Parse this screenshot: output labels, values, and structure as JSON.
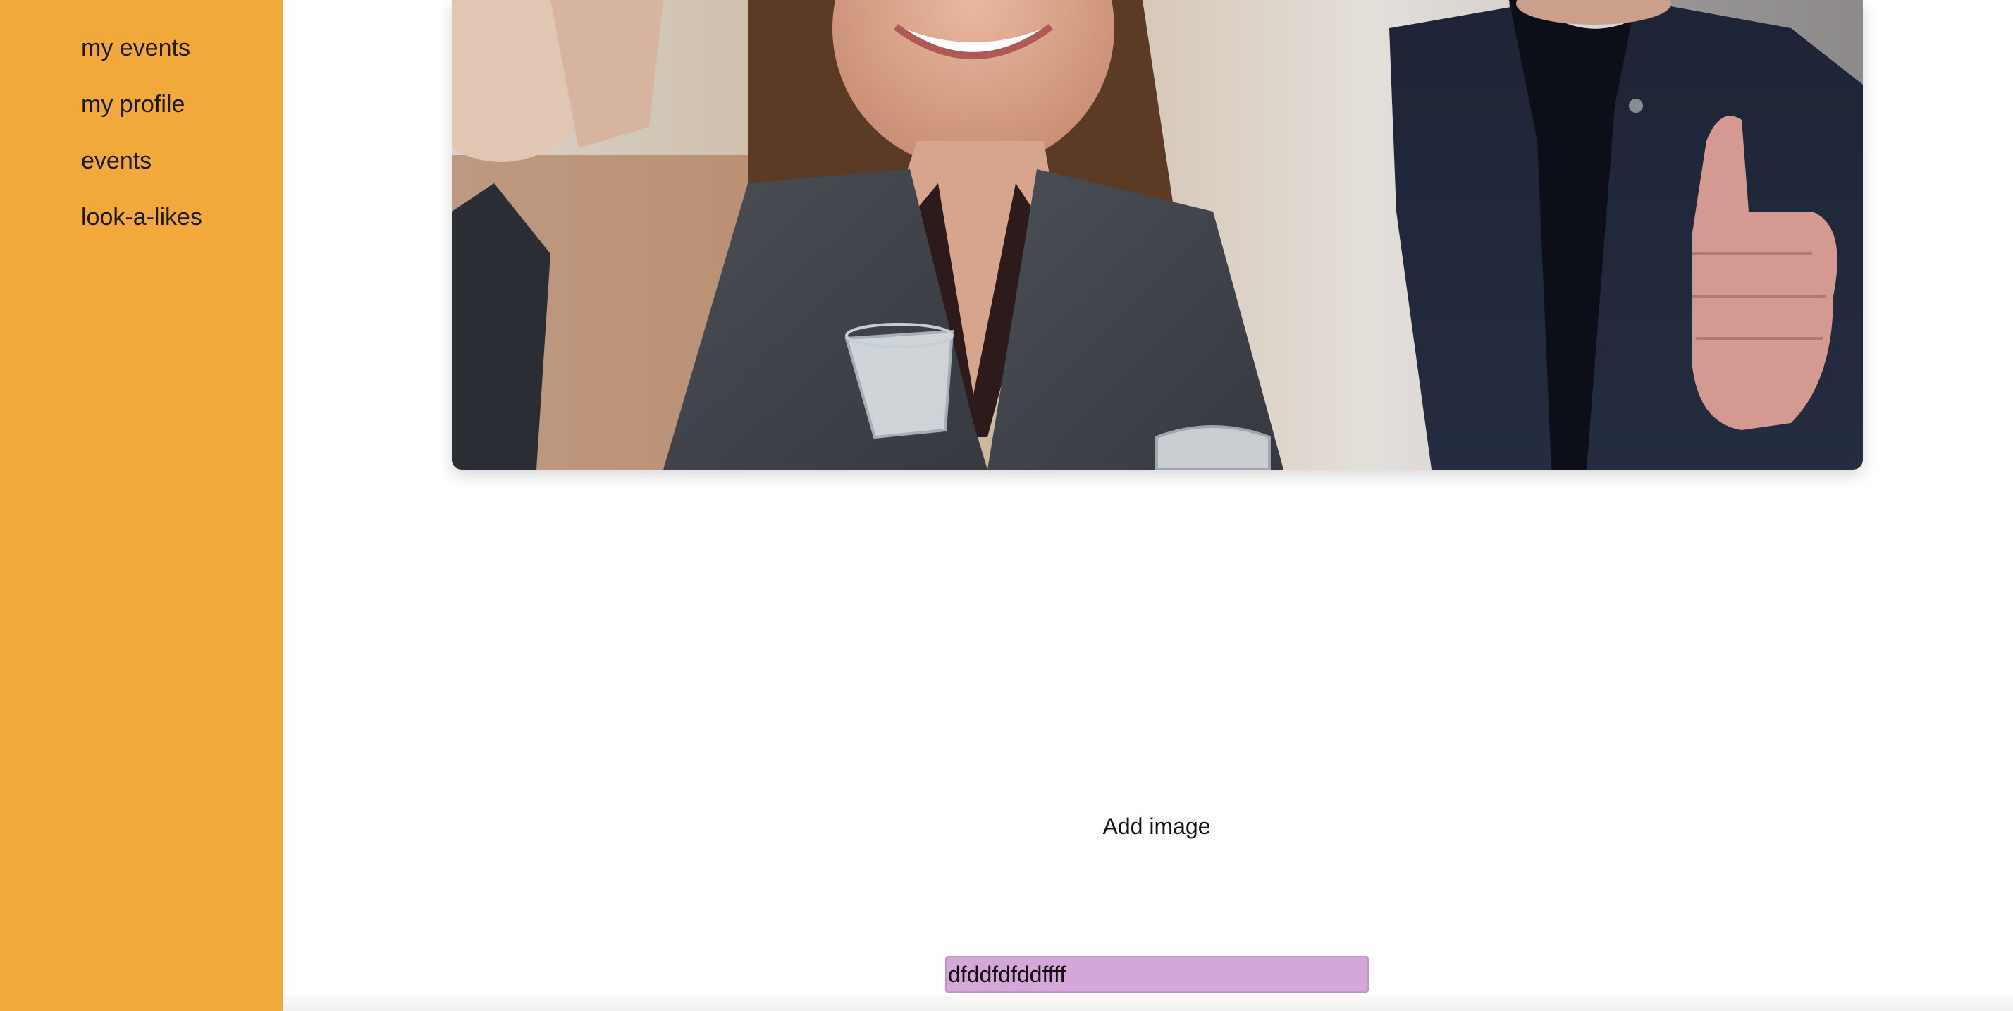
{
  "sidebar": {
    "items": [
      {
        "label": "my events"
      },
      {
        "label": "my profile"
      },
      {
        "label": "events"
      },
      {
        "label": "look-a-likes"
      }
    ]
  },
  "main": {
    "add_image_label": "Add image",
    "input_value": "dfddfdfddffff"
  },
  "colors": {
    "sidebar_bg": "#f2a93b",
    "input_bg": "#d5a6d8"
  }
}
